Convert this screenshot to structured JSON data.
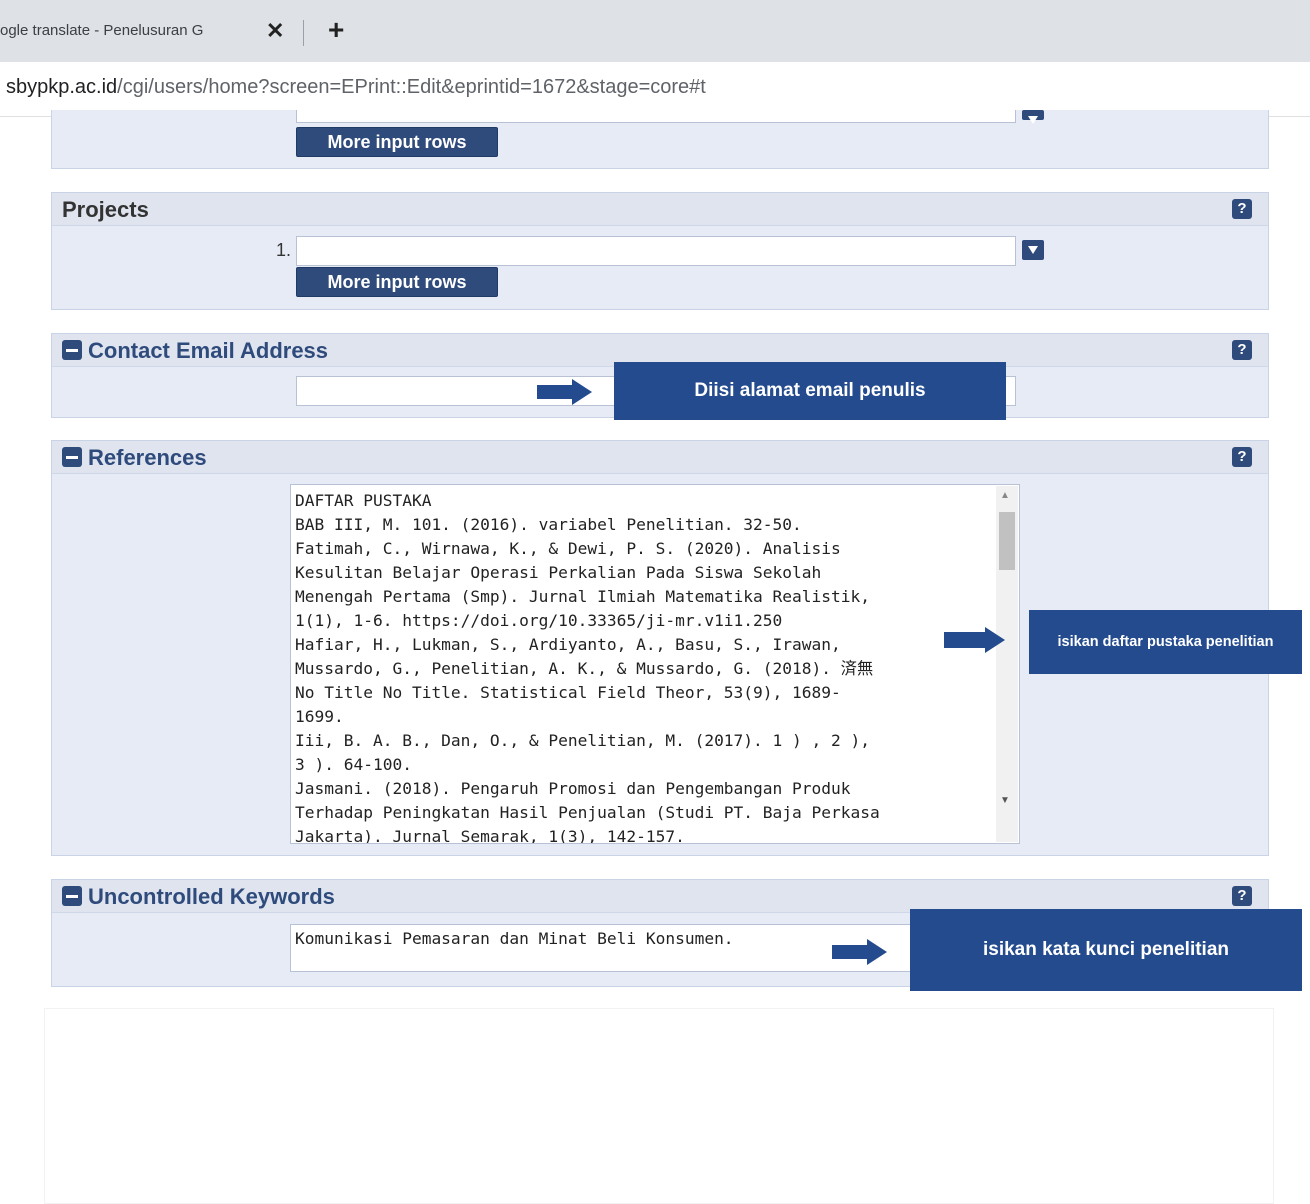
{
  "browser": {
    "tab_title": "ogle translate - Penelusuran G",
    "tab_close": "✕",
    "new_tab": "+",
    "url_host": "sbypkp.ac.id",
    "url_rest": "/cgi/users/home?screen=EPrint::Edit&eprintid=1672&stage=core#t"
  },
  "top_section": {
    "more_rows": "More input rows"
  },
  "projects": {
    "title": "Projects",
    "help": "?",
    "row_number": "1.",
    "more_rows": "More input rows"
  },
  "contact_email": {
    "title": "Contact Email Address",
    "help": "?",
    "value": ""
  },
  "references": {
    "title": "References",
    "help": "?",
    "lines": [
      "DAFTAR PUSTAKA",
      "BAB III, M. 101. (2016). variabel Penelitian. 32-50.",
      "Fatimah, C., Wirnawa, K., & Dewi, P. S. (2020). Analisis",
      "Kesulitan Belajar Operasi Perkalian Pada Siswa Sekolah",
      "Menengah Pertama (Smp). Jurnal Ilmiah Matematika Realistik,",
      "1(1), 1-6. https://doi.org/10.33365/ji-mr.v1i1.250",
      "Hafiar, H., Lukman, S., Ardiyanto, A., Basu, S., Irawan,",
      "Mussardo, G., Penelitian, A. K., & Mussardo, G. (2018). 済無",
      "No Title No Title. Statistical Field Theor, 53(9), 1689-",
      "1699.",
      "Iii, B. A. B., Dan, O., & Penelitian, M. (2017). 1 ) , 2 ),",
      "3 ). 64-100.",
      "Jasmani. (2018). Pengaruh Promosi dan Pengembangan Produk",
      "Terhadap Peningkatan Hasil Penjualan (Studi PT. Baja Perkasa",
      "Jakarta). Jurnal Semarak, 1(3), 142-157."
    ]
  },
  "keywords": {
    "title": "Uncontrolled Keywords",
    "help": "?",
    "value": "Komunikasi Pemasaran dan Minat Beli Konsumen."
  },
  "annotations": {
    "email_note": "Diisi alamat email penulis",
    "references_note": "isikan daftar pustaka penelitian",
    "keywords_note": "isikan kata kunci penelitian"
  },
  "colors": {
    "accent": "#2f4b7c",
    "callout": "#244b8e",
    "panel_bg": "#e6ebf6"
  }
}
